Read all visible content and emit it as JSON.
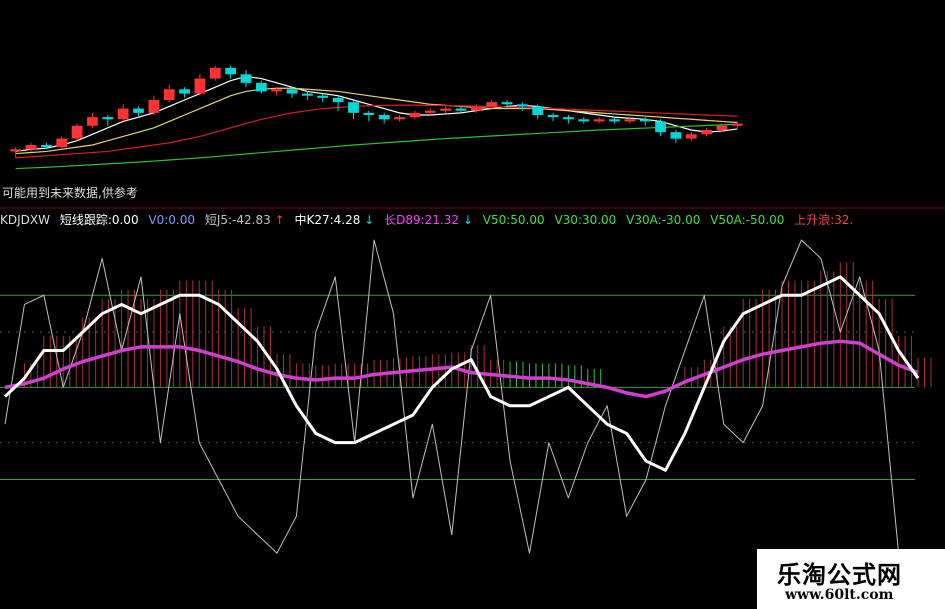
{
  "note": "可能用到未来数据,供参考",
  "indicator": {
    "name": "KDJDXW",
    "items": [
      {
        "label": "短线跟踪:0.00",
        "color": "#ffffff"
      },
      {
        "label": "V0:0.00",
        "color": "#7f9cff"
      },
      {
        "label": "短J5:-42.83",
        "color": "#c0c0c0"
      },
      {
        "label": "↑",
        "color": "#ff4040"
      },
      {
        "label": "中K27:4.28",
        "color": "#ffffff"
      },
      {
        "label": "↓",
        "color": "#00e0e0"
      },
      {
        "label": "长D89:21.32",
        "color": "#ff40ff"
      },
      {
        "label": "↓",
        "color": "#00e0e0"
      },
      {
        "label": "V50:50.00",
        "color": "#40e040"
      },
      {
        "label": "V30:30.00",
        "color": "#40e040"
      },
      {
        "label": "V30A:-30.00",
        "color": "#40e040"
      },
      {
        "label": "V50A:-50.00",
        "color": "#40e040"
      },
      {
        "label": "上升浪:32.",
        "color": "#ff4040"
      }
    ]
  },
  "watermark": {
    "title": "乐淘公式网",
    "url": "www.60lt.com"
  },
  "colors": {
    "up": "#ff3333",
    "down": "#00d8d8",
    "ma_white": "#ffffff",
    "ma_yellow": "#e8d070",
    "ma_red": "#d02020",
    "ma_green": "#30c030",
    "k_line": "#ffffff",
    "d_line": "#d040d0",
    "j_line": "#c0c0c0",
    "level_line": "#30a030",
    "bar_up": "#b03030",
    "bar_green": "#40c040"
  },
  "chart_data": [
    {
      "type": "candlestick",
      "series": [
        {
          "name": "candles",
          "values": [
            [
              18,
              19,
              15,
              20
            ],
            [
              19,
              21,
              18,
              22
            ],
            [
              21,
              20,
              19,
              22
            ],
            [
              20,
              24,
              19,
              25
            ],
            [
              24,
              30,
              23,
              31
            ],
            [
              30,
              34,
              29,
              36
            ],
            [
              34,
              33,
              30,
              35
            ],
            [
              33,
              38,
              32,
              40
            ],
            [
              38,
              36,
              34,
              39
            ],
            [
              36,
              42,
              35,
              44
            ],
            [
              42,
              47,
              41,
              49
            ],
            [
              47,
              45,
              43,
              48
            ],
            [
              45,
              52,
              44,
              54
            ],
            [
              52,
              57,
              51,
              58
            ],
            [
              57,
              54,
              52,
              58
            ],
            [
              54,
              50,
              48,
              56
            ],
            [
              50,
              46,
              45,
              51
            ],
            [
              46,
              47,
              44,
              48
            ],
            [
              47,
              45,
              43,
              48
            ],
            [
              45,
              44,
              42,
              46
            ],
            [
              44,
              43,
              41,
              45
            ],
            [
              43,
              41,
              37,
              44
            ],
            [
              41,
              36,
              33,
              42
            ],
            [
              36,
              35,
              32,
              37
            ],
            [
              35,
              33,
              31,
              36
            ],
            [
              33,
              34,
              32,
              35
            ],
            [
              34,
              36,
              33,
              37
            ],
            [
              36,
              37,
              35,
              38
            ],
            [
              37,
              38,
              36,
              39
            ],
            [
              38,
              37,
              36,
              39
            ],
            [
              37,
              39,
              36,
              40
            ],
            [
              39,
              41,
              38,
              42
            ],
            [
              41,
              40,
              38,
              42
            ],
            [
              40,
              39,
              37,
              41
            ],
            [
              39,
              35,
              33,
              40
            ],
            [
              35,
              34,
              32,
              36
            ],
            [
              34,
              33,
              31,
              35
            ],
            [
              33,
              32,
              31,
              34
            ],
            [
              32,
              33,
              31,
              34
            ],
            [
              33,
              32,
              31,
              34
            ],
            [
              32,
              33,
              31,
              34
            ],
            [
              33,
              32,
              30,
              34
            ],
            [
              32,
              27,
              25,
              33
            ],
            [
              27,
              24,
              22,
              28
            ],
            [
              24,
              26,
              23,
              27
            ],
            [
              26,
              28,
              25,
              29
            ],
            [
              28,
              30,
              27,
              31
            ],
            [
              30,
              31,
              29,
              32
            ]
          ]
        },
        {
          "name": "MA5",
          "values": [
            18,
            19,
            19.5,
            21,
            23,
            26,
            29,
            32,
            34,
            36,
            39,
            42,
            45,
            48,
            51,
            53,
            52,
            50,
            48,
            46,
            45,
            44,
            42,
            40,
            38,
            36,
            35,
            35,
            35.5,
            36,
            37,
            38,
            39,
            39.5,
            39,
            38,
            37,
            36,
            35,
            34,
            33.5,
            33,
            32,
            30,
            28,
            27,
            27.5,
            28.5
          ]
        },
        {
          "name": "MA10",
          "values": [
            17,
            17.5,
            18,
            19,
            20,
            21,
            23,
            25,
            27,
            29,
            32,
            35,
            38,
            41,
            44,
            46,
            47,
            47.5,
            47.5,
            47,
            46.5,
            46,
            45,
            44,
            43,
            42,
            41,
            40,
            39.5,
            39,
            38.5,
            38,
            38,
            38,
            38,
            37.5,
            37,
            36.5,
            36,
            35.5,
            35,
            34.5,
            34,
            33.5,
            33,
            32.5,
            32,
            31.5
          ]
        },
        {
          "name": "MA20",
          "values": [
            15,
            15.5,
            16,
            16.5,
            17,
            17.5,
            18,
            19,
            20,
            21,
            22,
            23.5,
            25,
            27,
            29,
            31,
            33,
            34.5,
            36,
            37,
            38,
            38.5,
            39,
            39.3,
            39.5,
            39.6,
            39.6,
            39.5,
            39.4,
            39.3,
            39.1,
            38.9,
            38.7,
            38.5,
            38.3,
            38,
            37.7,
            37.4,
            37.1,
            36.8,
            36.5,
            36.2,
            35.9,
            35.6,
            35.3,
            35,
            34.7,
            34.4
          ]
        },
        {
          "name": "MA60",
          "values": [
            10,
            10.3,
            10.6,
            11,
            11.4,
            11.8,
            12.2,
            12.6,
            13,
            13.5,
            14,
            14.5,
            15,
            15.6,
            16.2,
            16.8,
            17.4,
            18,
            18.6,
            19.2,
            19.8,
            20.4,
            21,
            21.5,
            22,
            22.5,
            23,
            23.5,
            24,
            24.4,
            24.8,
            25.2,
            25.6,
            26,
            26.4,
            26.8,
            27.2,
            27.6,
            28,
            28.3,
            28.6,
            28.9,
            29.2,
            29.5,
            29.8,
            30.1,
            30.4,
            30.7
          ]
        }
      ],
      "ylim": [
        0,
        70
      ]
    },
    {
      "type": "line",
      "x": [
        0,
        1,
        2,
        3,
        4,
        5,
        6,
        7,
        8,
        9,
        10,
        11,
        12,
        13,
        14,
        15,
        16,
        17,
        18,
        19,
        20,
        21,
        22,
        23,
        24,
        25,
        26,
        27,
        28,
        29,
        30,
        31,
        32,
        33,
        34,
        35,
        36,
        37,
        38,
        39,
        40,
        41,
        42,
        43,
        44,
        45,
        46,
        47
      ],
      "series": [
        {
          "name": "中K27",
          "values": [
            -5,
            5,
            20,
            20,
            30,
            40,
            45,
            40,
            45,
            50,
            50,
            45,
            35,
            25,
            10,
            -10,
            -25,
            -30,
            -30,
            -25,
            -20,
            -15,
            0,
            10,
            15,
            -5,
            -10,
            -10,
            -5,
            0,
            -10,
            -20,
            -25,
            -40,
            -45,
            -25,
            0,
            25,
            40,
            45,
            50,
            50,
            55,
            60,
            50,
            40,
            20,
            5
          ]
        },
        {
          "name": "长D89",
          "values": [
            0,
            2,
            5,
            10,
            14,
            17,
            20,
            22,
            22,
            22,
            20,
            17,
            14,
            10,
            7,
            5,
            4,
            5,
            5,
            7,
            8,
            9,
            10,
            11,
            8,
            7,
            6,
            5,
            5,
            4,
            2,
            0,
            -3,
            -5,
            -2,
            3,
            7,
            11,
            15,
            18,
            20,
            22,
            24,
            25,
            24,
            18,
            12,
            8
          ]
        },
        {
          "name": "短J5",
          "values": [
            -20,
            45,
            50,
            0,
            30,
            70,
            20,
            60,
            -30,
            40,
            -30,
            -50,
            -70,
            -80,
            -90,
            -70,
            30,
            60,
            -30,
            80,
            40,
            -60,
            -20,
            -80,
            20,
            50,
            -40,
            -90,
            -30,
            -60,
            -30,
            -10,
            -70,
            -50,
            -10,
            20,
            50,
            -20,
            -30,
            -10,
            55,
            80,
            70,
            30,
            60,
            20,
            -90,
            -100
          ]
        },
        {
          "name": "短线跟踪",
          "values": [
            50,
            40,
            40,
            40,
            45,
            45,
            45,
            40,
            40,
            35,
            30,
            25,
            20,
            15,
            10,
            0,
            0,
            0,
            0,
            0,
            0,
            0,
            0,
            0,
            0,
            0,
            0,
            0,
            0,
            0,
            0,
            0,
            0,
            0,
            0,
            30,
            40,
            45,
            50,
            50,
            55,
            50,
            45,
            45,
            40,
            30,
            20,
            10
          ]
        }
      ],
      "levels": [
        50,
        0,
        -50
      ],
      "ylim": [
        -110,
        80
      ]
    }
  ]
}
